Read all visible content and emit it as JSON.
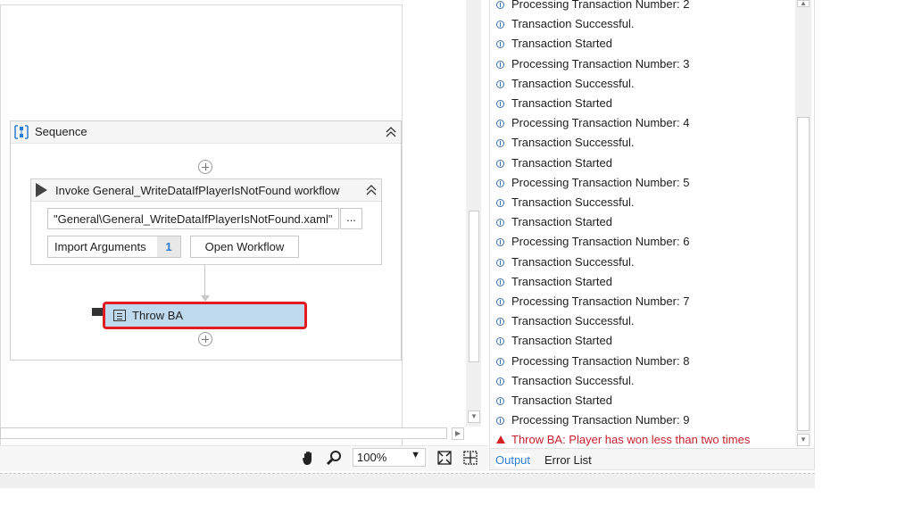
{
  "designer": {
    "sequence": {
      "title": "Sequence"
    },
    "invoke": {
      "title": "Invoke General_WriteDataIfPlayerIsNotFound workflow",
      "path_value": "\"General\\General_WriteDataIfPlayerIsNotFound.xaml\"",
      "browse_label": "...",
      "import_label": "Import Arguments",
      "import_count": "1",
      "open_label": "Open Workflow"
    },
    "throw": {
      "label": "Throw BA"
    }
  },
  "toolbar": {
    "zoom": "100%"
  },
  "output": {
    "rows": [
      {
        "type": "info",
        "text": "Processing Transaction Number: 2"
      },
      {
        "type": "info",
        "text": "Transaction Successful."
      },
      {
        "type": "info",
        "text": "Transaction Started"
      },
      {
        "type": "info",
        "text": "Processing Transaction Number: 3"
      },
      {
        "type": "info",
        "text": "Transaction Successful."
      },
      {
        "type": "info",
        "text": "Transaction Started"
      },
      {
        "type": "info",
        "text": "Processing Transaction Number: 4"
      },
      {
        "type": "info",
        "text": "Transaction Successful."
      },
      {
        "type": "info",
        "text": "Transaction Started"
      },
      {
        "type": "info",
        "text": "Processing Transaction Number: 5"
      },
      {
        "type": "info",
        "text": "Transaction Successful."
      },
      {
        "type": "info",
        "text": "Transaction Started"
      },
      {
        "type": "info",
        "text": "Processing Transaction Number: 6"
      },
      {
        "type": "info",
        "text": "Transaction Successful."
      },
      {
        "type": "info",
        "text": "Transaction Started"
      },
      {
        "type": "info",
        "text": "Processing Transaction Number: 7"
      },
      {
        "type": "info",
        "text": "Transaction Successful."
      },
      {
        "type": "info",
        "text": "Transaction Started"
      },
      {
        "type": "info",
        "text": "Processing Transaction Number: 8"
      },
      {
        "type": "info",
        "text": "Transaction Successful."
      },
      {
        "type": "info",
        "text": "Transaction Started"
      },
      {
        "type": "info",
        "text": "Processing Transaction Number: 9"
      },
      {
        "type": "error",
        "text": "Throw BA: Player has won less than two times"
      }
    ],
    "tabs": [
      "Output",
      "Error List"
    ]
  },
  "colors": {
    "accent": "#2b7cd3",
    "error": "#c5202f",
    "selection": "#bfd9ee",
    "highlight_border": "#e31b23"
  }
}
